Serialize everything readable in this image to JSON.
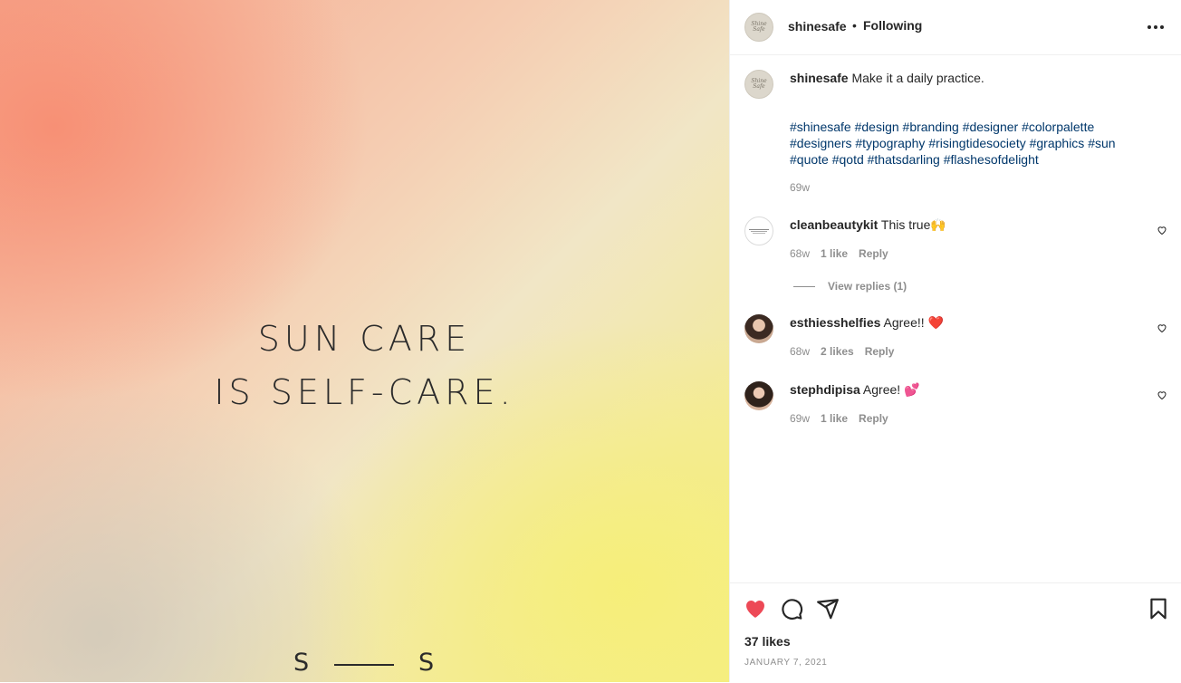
{
  "post_image": {
    "quote_line1": "SUN CARE",
    "quote_line2": "IS SELF-CARE.",
    "mark_left": "S",
    "mark_right": "S"
  },
  "header": {
    "username": "shinesafe",
    "separator": "•",
    "follow_status": "Following",
    "avatar_text": "Shine Safe"
  },
  "caption": {
    "username": "shinesafe",
    "text": "Make it a daily practice.",
    "hashtags": "#shinesafe #design #branding #designer #colorpalette #designers #typography #risingtidesociety #graphics #sun #quote #qotd #thatsdarling #flashesofdelight",
    "age": "69w"
  },
  "comments": [
    {
      "username": "cleanbeautykit",
      "text": "This true🙌",
      "age": "68w",
      "likes": "1 like",
      "reply": "Reply"
    },
    {
      "username": "esthiesshelfies",
      "text": "Agree!! ❤️",
      "age": "68w",
      "likes": "2 likes",
      "reply": "Reply"
    },
    {
      "username": "stephdipisa",
      "text": "Agree! 💕",
      "age": "69w",
      "likes": "1 like",
      "reply": "Reply"
    }
  ],
  "view_replies": "View replies (1)",
  "footer": {
    "likes": "37 likes",
    "date": "JANUARY 7, 2021"
  },
  "colors": {
    "like_red": "#ed4956",
    "hashtag_blue": "#00376b",
    "muted_gray": "#8e8e8e"
  }
}
